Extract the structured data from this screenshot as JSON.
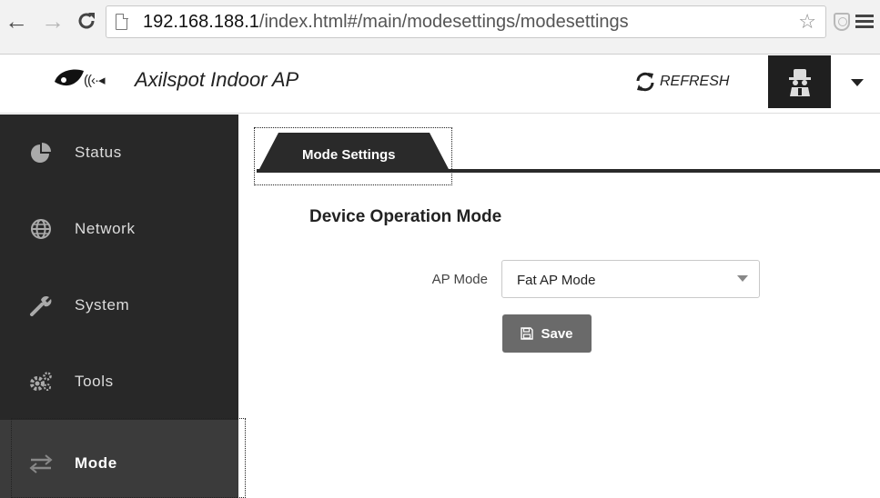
{
  "browser": {
    "url_host": "192.168.188.1",
    "url_path": "/index.html#/main/modesettings/modesettings"
  },
  "header": {
    "app_title": "Axilspot Indoor AP",
    "refresh_label": "REFRESH"
  },
  "sidebar": {
    "items": [
      {
        "label": "Status",
        "icon": "pie-chart-icon"
      },
      {
        "label": "Network",
        "icon": "globe-icon"
      },
      {
        "label": "System",
        "icon": "wrench-icon"
      },
      {
        "label": "Tools",
        "icon": "gears-icon"
      },
      {
        "label": "Mode",
        "icon": "exchange-arrows-icon",
        "active": true
      }
    ]
  },
  "main": {
    "tab_label": "Mode Settings",
    "section_title": "Device Operation Mode",
    "ap_mode": {
      "label": "AP Mode",
      "value": "Fat AP Mode"
    },
    "save_label": "Save"
  }
}
